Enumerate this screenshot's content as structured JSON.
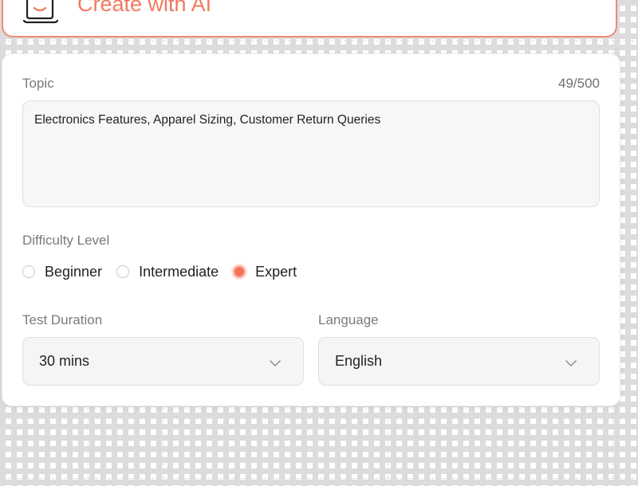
{
  "banner": {
    "title": "Create with AI",
    "icon": "magic-hat-icon",
    "accent_color": "#f07a60"
  },
  "form": {
    "topic": {
      "label": "Topic",
      "counter": "49/500",
      "value": "Electronics Features, Apparel Sizing, Customer Return Queries"
    },
    "difficulty": {
      "label": "Difficulty Level",
      "options": [
        "Beginner",
        "Intermediate",
        "Expert"
      ],
      "selected": "Expert",
      "accent_color": "#f5735a"
    },
    "duration": {
      "label": "Test Duration",
      "value": "30 mins",
      "icon": "chevron-down-icon"
    },
    "language": {
      "label": "Language",
      "value": "English",
      "icon": "chevron-down-icon"
    }
  }
}
